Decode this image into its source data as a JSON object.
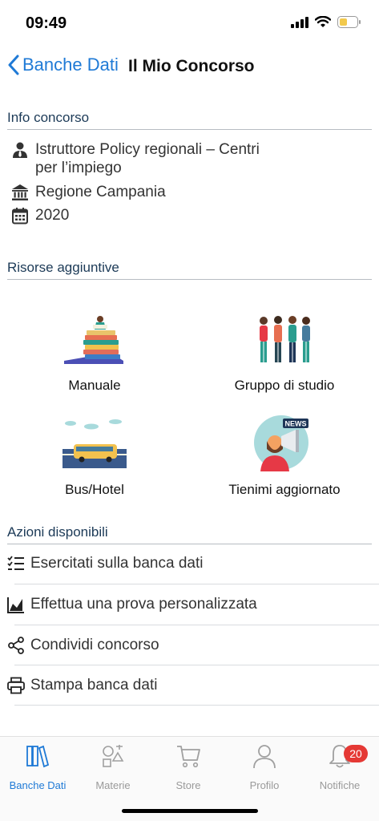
{
  "status": {
    "time": "09:49"
  },
  "nav": {
    "back_label": "Banche Dati",
    "title": "Il Mio Concorso"
  },
  "info": {
    "header": "Info concorso",
    "role": "Istruttore Policy regionali – Centri per l’impiego",
    "entity": "Regione Campania",
    "year": "2020"
  },
  "resources": {
    "header": "Risorse aggiuntive",
    "items": [
      {
        "label": "Manuale",
        "icon": "books-reading-icon"
      },
      {
        "label": "Gruppo di studio",
        "icon": "study-group-icon"
      },
      {
        "label": "Bus/Hotel",
        "icon": "bus-icon"
      },
      {
        "label": "Tienimi aggiornato",
        "icon": "news-megaphone-icon"
      }
    ]
  },
  "actions": {
    "header": "Azioni disponibili",
    "items": [
      {
        "label": "Esercitati sulla banca dati",
        "icon": "checklist-icon"
      },
      {
        "label": "Effettua una prova personalizzata",
        "icon": "chart-icon"
      },
      {
        "label": "Condividi concorso",
        "icon": "share-icon"
      },
      {
        "label": "Stampa banca dati",
        "icon": "print-icon"
      }
    ]
  },
  "tabs": [
    {
      "label": "Banche Dati",
      "icon": "books-icon",
      "active": true
    },
    {
      "label": "Materie",
      "icon": "subjects-icon"
    },
    {
      "label": "Store",
      "icon": "cart-icon"
    },
    {
      "label": "Profilo",
      "icon": "person-icon"
    },
    {
      "label": "Notifiche",
      "icon": "bell-icon",
      "badge": "20"
    }
  ],
  "colors": {
    "accent": "#1f7ad6",
    "badge": "#e53935",
    "section_text": "#1c3a57"
  }
}
